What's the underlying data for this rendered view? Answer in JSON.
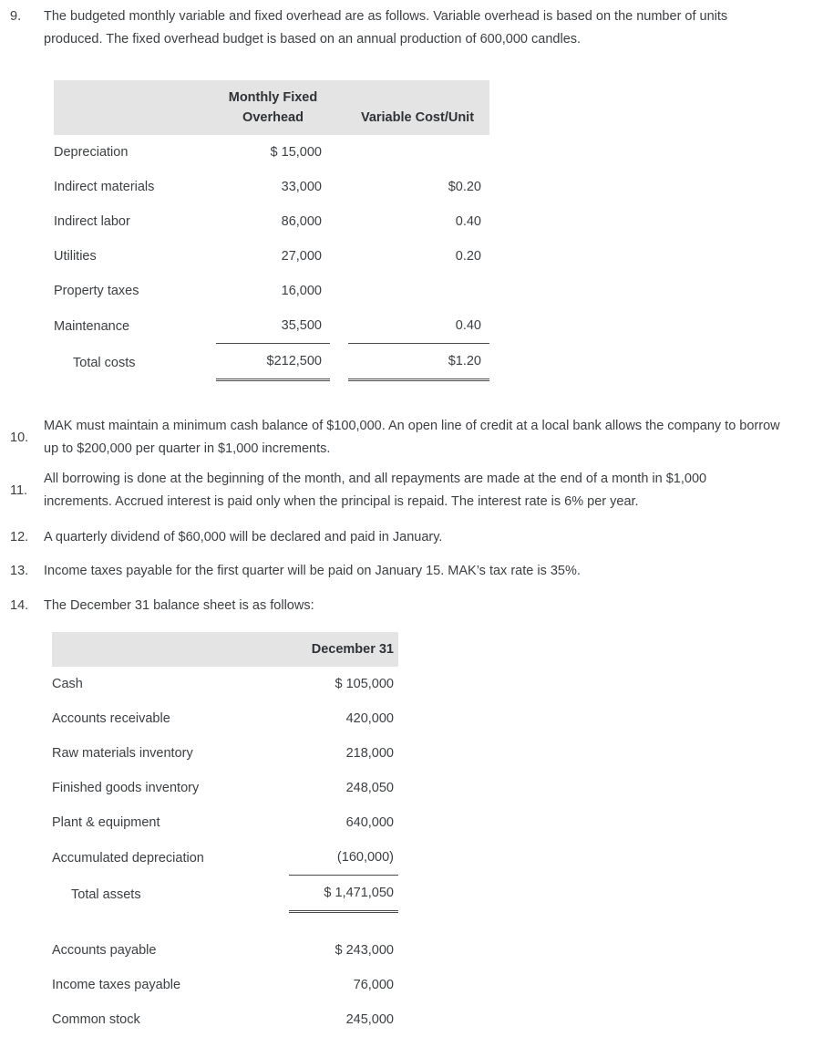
{
  "items": [
    {
      "number": "9.",
      "text": "The budgeted monthly variable and fixed overhead are as follows. Variable overhead is based on the number of units produced. The fixed overhead budget is based on an annual production of 600,000 candles."
    },
    {
      "number": "10.",
      "text": "MAK must maintain a minimum cash balance of $100,000. An open line of credit at a local bank allows the company to borrow up to $200,000 per quarter in $1,000 increments."
    },
    {
      "number": "11.",
      "text": "All borrowing is done at the beginning of the month, and all repayments are made at the end of a month in $1,000 increments. Accrued interest is paid only when the principal is repaid. The interest rate is 6% per year."
    },
    {
      "number": "12.",
      "text": "A quarterly dividend of $60,000 will be declared and paid in January."
    },
    {
      "number": "13.",
      "text": "Income taxes payable for the first quarter will be paid on January 15. MAK’s tax rate is 35%."
    },
    {
      "number": "14.",
      "text": "The December 31 balance sheet is as follows:"
    }
  ],
  "overhead_table": {
    "headers": {
      "label": "",
      "fixed_line1": "Monthly Fixed",
      "fixed_line2": "Overhead",
      "variable": "Variable Cost/Unit"
    },
    "rows": [
      {
        "label": "Depreciation",
        "fixed": "$ 15,000",
        "variable": ""
      },
      {
        "label": "Indirect materials",
        "fixed": "33,000",
        "variable": "$0.20"
      },
      {
        "label": "Indirect labor",
        "fixed": "86,000",
        "variable": "0.40"
      },
      {
        "label": "Utilities",
        "fixed": "27,000",
        "variable": "0.20"
      },
      {
        "label": "Property taxes",
        "fixed": "16,000",
        "variable": ""
      },
      {
        "label": "Maintenance",
        "fixed": "35,500",
        "variable": "0.40"
      }
    ],
    "total": {
      "label": "Total costs",
      "fixed": "$212,500",
      "variable": "$1.20"
    }
  },
  "balance_table": {
    "headers": {
      "label": "",
      "amount": "December 31"
    },
    "asset_rows": [
      {
        "label": "Cash",
        "amount": "$ 105,000"
      },
      {
        "label": "Accounts receivable",
        "amount": "420,000"
      },
      {
        "label": "Raw materials inventory",
        "amount": "218,000"
      },
      {
        "label": "Finished goods inventory",
        "amount": "248,050"
      },
      {
        "label": "Plant & equipment",
        "amount": "640,000"
      },
      {
        "label": "Accumulated depreciation",
        "amount": "(160,000)"
      }
    ],
    "total_assets": {
      "label": "Total assets",
      "amount": "$ 1,471,050"
    },
    "liability_rows": [
      {
        "label": "Accounts payable",
        "amount": "$ 243,000"
      },
      {
        "label": "Income taxes payable",
        "amount": "76,000"
      },
      {
        "label": "Common stock",
        "amount": "245,000"
      }
    ]
  },
  "colors": {
    "header_bg": "#e4e4e4",
    "text": "#3c4043",
    "rule": "#4a4a4a"
  }
}
